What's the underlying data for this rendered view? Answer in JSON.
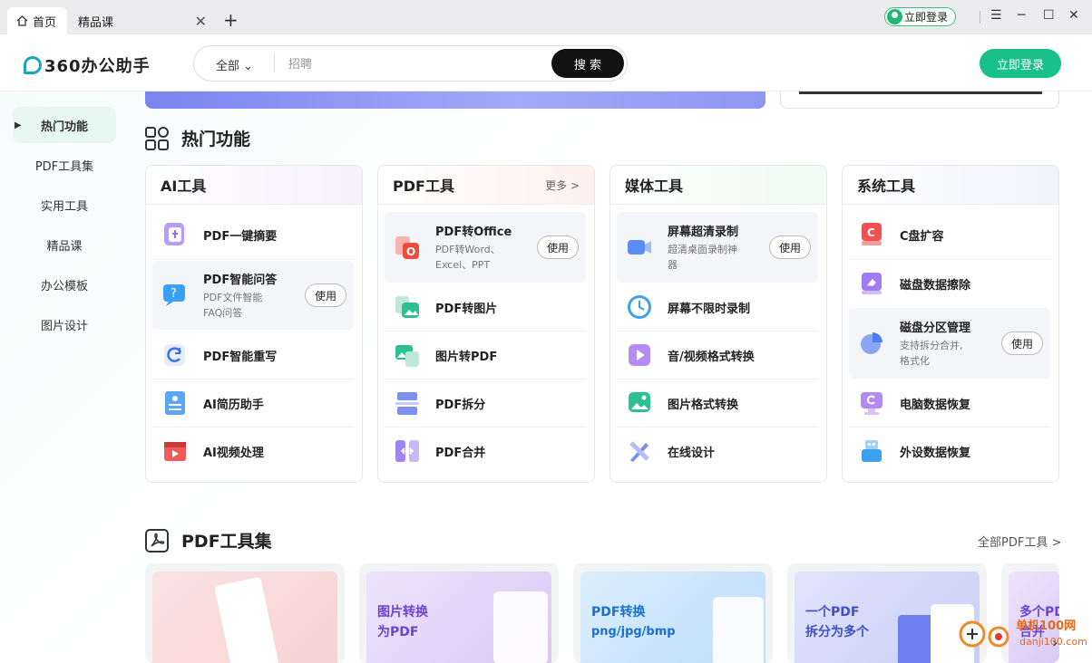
{
  "tabs": {
    "home": "首页",
    "course": "精品课"
  },
  "titlebar": {
    "login_pill": "立即登录"
  },
  "header": {
    "logo_text": "360办公助手",
    "search_scope": "全部",
    "search_placeholder": "招聘",
    "search_button": "搜 索",
    "login_button": "立即登录"
  },
  "sidebar": {
    "items": [
      {
        "label": "热门功能",
        "active": true
      },
      {
        "label": "PDF工具集"
      },
      {
        "label": "实用工具"
      },
      {
        "label": "精品课"
      },
      {
        "label": "办公模板"
      },
      {
        "label": "图片设计"
      }
    ]
  },
  "hot": {
    "title": "热门功能",
    "use_label": "使用",
    "cards": [
      {
        "title": "AI工具",
        "items": [
          {
            "name": "PDF一键摘要",
            "icon": "summary-icon"
          },
          {
            "name": "PDF智能问答",
            "desc1": "PDF文件智能",
            "desc2": "FAQ问答",
            "icon": "qa-icon"
          },
          {
            "name": "PDF智能重写",
            "icon": "rewrite-icon"
          },
          {
            "name": "AI简历助手",
            "icon": "resume-icon"
          },
          {
            "name": "AI视频处理",
            "icon": "video-clapper-icon"
          }
        ]
      },
      {
        "title": "PDF工具",
        "more": "更多 >",
        "items": [
          {
            "name": "PDF转Office",
            "desc1": "PDF转Word、",
            "desc2": "Excel、PPT",
            "icon": "pdf-to-office-icon"
          },
          {
            "name": "PDF转图片",
            "icon": "pdf-to-image-icon"
          },
          {
            "name": "图片转PDF",
            "icon": "image-to-pdf-icon"
          },
          {
            "name": "PDF拆分",
            "icon": "pdf-split-icon"
          },
          {
            "name": "PDF合并",
            "icon": "pdf-merge-icon"
          }
        ]
      },
      {
        "title": "媒体工具",
        "items": [
          {
            "name": "屏幕超清录制",
            "desc1": "超清桌面录制神",
            "desc2": "器",
            "icon": "screen-record-icon"
          },
          {
            "name": "屏幕不限时录制",
            "icon": "clock-icon"
          },
          {
            "name": "音/视频格式转换",
            "icon": "play-icon"
          },
          {
            "name": "图片格式转换",
            "icon": "image-convert-icon"
          },
          {
            "name": "在线设计",
            "icon": "design-tools-icon"
          }
        ]
      },
      {
        "title": "系统工具",
        "items": [
          {
            "name": "C盘扩容",
            "icon": "c-drive-icon"
          },
          {
            "name": "磁盘数据擦除",
            "icon": "eraser-icon"
          },
          {
            "name": "磁盘分区管理",
            "desc1": "支持拆分合并,",
            "desc2": "格式化",
            "icon": "pie-partition-icon"
          },
          {
            "name": "电脑数据恢复",
            "icon": "pc-recover-icon"
          },
          {
            "name": "外设数据恢复",
            "icon": "usb-recover-icon"
          }
        ]
      }
    ]
  },
  "pdfset": {
    "title": "PDF工具集",
    "all_link": "全部PDF工具 >",
    "cards": [
      {
        "l1": "",
        "l2": ""
      },
      {
        "l1": "图片转换",
        "l2": "为PDF"
      },
      {
        "l1": "PDF转换",
        "l2": "png/jpg/bmp"
      },
      {
        "l1": "一个PDF",
        "l2": "拆分为多个"
      },
      {
        "l1": "多个PD",
        "l2": "合并"
      }
    ]
  },
  "watermark": {
    "t1": "单机100网",
    "t2": "danji100.com"
  }
}
